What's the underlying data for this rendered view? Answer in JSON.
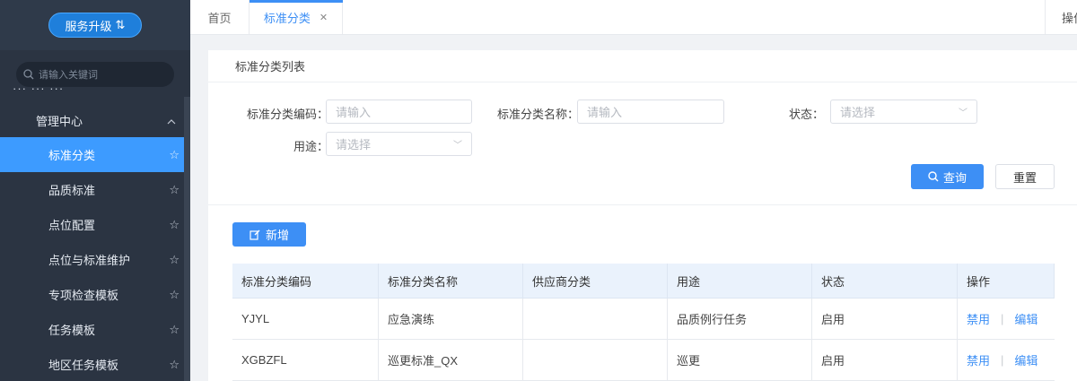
{
  "sidebar": {
    "upgrade_label": "服务升级",
    "search_placeholder": "请输入关键词",
    "partial_header": "··· ··· ···",
    "group": "管理中心",
    "items": [
      {
        "label": "标准分类"
      },
      {
        "label": "品质标准"
      },
      {
        "label": "点位配置"
      },
      {
        "label": "点位与标准维护"
      },
      {
        "label": "专项检查模板"
      },
      {
        "label": "任务模板"
      },
      {
        "label": "地区任务模板"
      }
    ]
  },
  "tabs": {
    "home": "首页",
    "current": "标准分类",
    "ops": "操作"
  },
  "page": {
    "title": "标准分类列表"
  },
  "filters": {
    "code_label": "标准分类编码：",
    "code_placeholder": "请输入",
    "name_label": "标准分类名称：",
    "name_placeholder": "请输入",
    "status_label": "状态：",
    "status_placeholder": "请选择",
    "usage_label": "用途：",
    "usage_placeholder": "请选择",
    "query": "查询",
    "reset": "重置"
  },
  "actions": {
    "add": "新增"
  },
  "table": {
    "headers": [
      "标准分类编码",
      "标准分类名称",
      "供应商分类",
      "用途",
      "状态",
      "操作"
    ],
    "rows": [
      {
        "code": "YJYL",
        "name": "应急演练",
        "supplier": "",
        "usage": "品质例行任务",
        "status": "启用",
        "disable": "禁用",
        "edit": "编辑"
      },
      {
        "code": "XGBZFL",
        "name": "巡更标准_QX",
        "supplier": "",
        "usage": "巡更",
        "status": "启用",
        "disable": "禁用",
        "edit": "编辑"
      }
    ]
  },
  "colors": {
    "primary": "#3d8ff5",
    "sidebar_bg": "#2b3442"
  }
}
